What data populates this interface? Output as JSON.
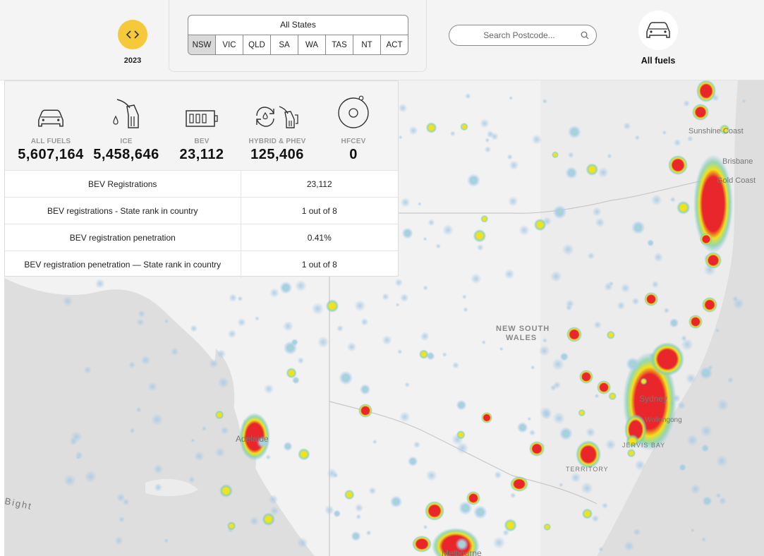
{
  "year": {
    "label": "2023",
    "nav_icon": "chevron-left-right-icon"
  },
  "states": {
    "all_label": "All States",
    "items": [
      "NSW",
      "VIC",
      "QLD",
      "SA",
      "WA",
      "TAS",
      "NT",
      "ACT"
    ],
    "selected": "NSW"
  },
  "search": {
    "placeholder": "Search Postcode...",
    "value": ""
  },
  "fuel_filter": {
    "label": "All fuels",
    "icon": "car-icon"
  },
  "stats": {
    "fuels": [
      {
        "label": "ALL FUELS",
        "value": "5,607,164",
        "icon": "car-icon"
      },
      {
        "label": "ICE",
        "value": "5,458,646",
        "icon": "fuel-pump-icon"
      },
      {
        "label": "BEV",
        "value": "23,112",
        "icon": "battery-icon"
      },
      {
        "label": "HYBRID & PHEV",
        "value": "125,406",
        "icon": "hybrid-icon"
      },
      {
        "label": "HFCEV",
        "value": "0",
        "icon": "hydrogen-icon"
      }
    ],
    "rows": [
      {
        "label": "BEV Registrations",
        "value": "23,112"
      },
      {
        "label": "BEV registrations - State rank in country",
        "value": "1 out of 8"
      },
      {
        "label": "BEV registration penetration",
        "value": "0.41%"
      },
      {
        "label": "BEV registration penetration — State rank in country",
        "value": "1 out of 8"
      }
    ]
  },
  "map": {
    "labels": [
      "NEW SOUTH",
      "WALES",
      "Sydney",
      "Gold Coast",
      "Sunshine Coast",
      "Adelaide",
      "Melbourne",
      "Bight",
      "JERVIS BAY",
      "TERRITORY",
      "Wollongong",
      "Brisbane"
    ],
    "colors": {
      "land": "#ececec",
      "water": "#dcdcdc",
      "hot": "#e8262b",
      "warm": "#f2e21a",
      "cool": "#7fd3a5",
      "cold": "#8bbde0"
    }
  }
}
